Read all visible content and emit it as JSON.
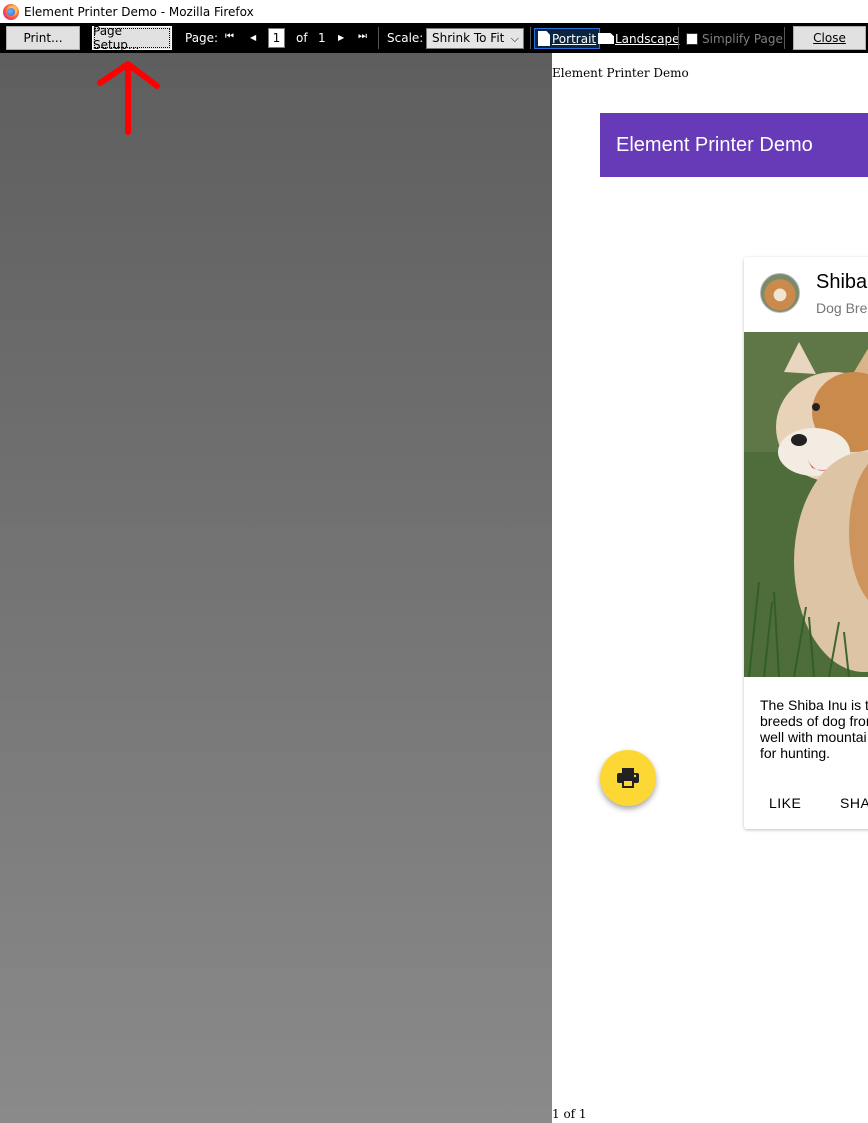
{
  "window": {
    "title": "Element Printer Demo - Mozilla Firefox"
  },
  "toolbar": {
    "print_label": "Print...",
    "page_setup_label": "Page Setup...",
    "page_label": "Page:",
    "page_current": "1",
    "page_of": "of",
    "page_total": "1",
    "scale_label": "Scale:",
    "scale_value": "Shrink To Fit",
    "portrait_label": "Portrait",
    "landscape_label": "Landscape",
    "simplify_label": "Simplify Page",
    "close_label": "Close"
  },
  "paper": {
    "header_text": "Element Printer Demo",
    "footer_text": "1 of 1",
    "appbar_title": "Element Printer Demo",
    "card": {
      "title": "Shiba",
      "subtitle": "Dog Bre",
      "text_lines": [
        "The Shiba Inu is t",
        "breeds of dog fror",
        "well with mountai",
        "for hunting."
      ],
      "actions": [
        "LIKE",
        "SHA"
      ]
    }
  },
  "colors": {
    "appbar": "#673ab7",
    "fab": "#fdd835",
    "annotation_arrow": "#ff0000"
  },
  "icons": {
    "fab": "print-icon",
    "annotation": "red-arrow-annotation"
  }
}
